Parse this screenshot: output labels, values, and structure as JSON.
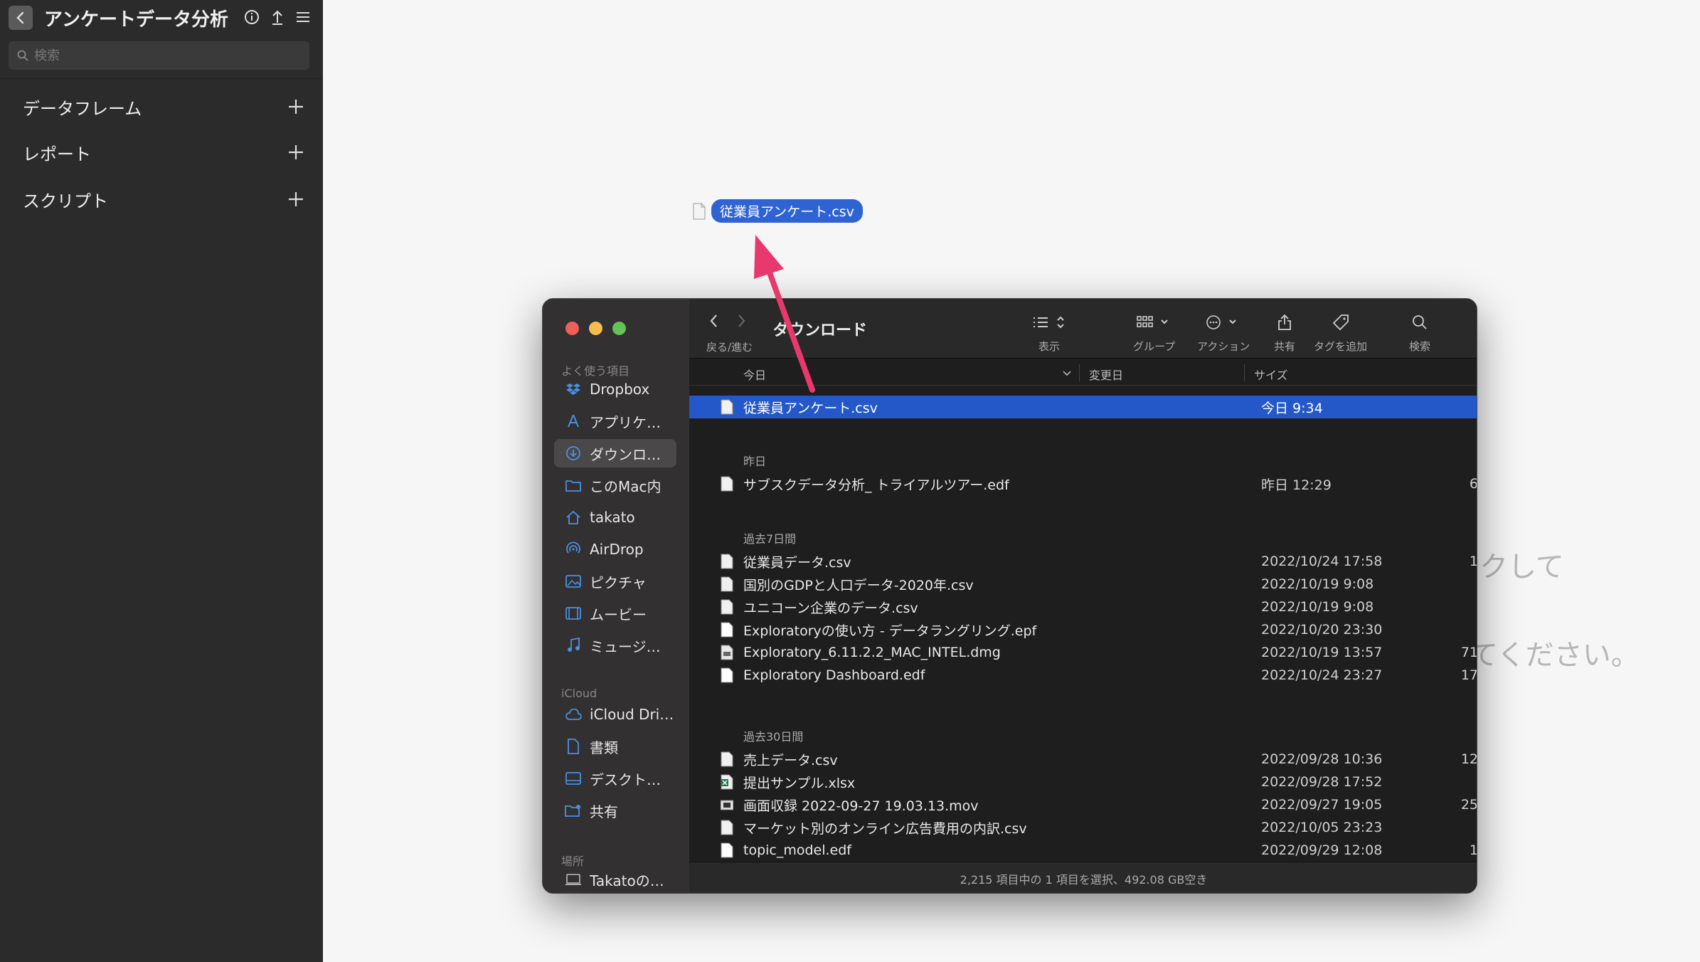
{
  "app": {
    "title": "アンケートデータ分析",
    "search_placeholder": "検索",
    "sections": [
      {
        "label": "データフレーム"
      },
      {
        "label": "レポート"
      },
      {
        "label": "スクリプト"
      }
    ]
  },
  "background_text": {
    "line1": "クして",
    "line2": "てください。"
  },
  "drag": {
    "file_name": "従業員アンケート.csv"
  },
  "finder": {
    "folder_title": "ダウンロード",
    "nav_label": "戻る/進む",
    "toolbar": {
      "view": "表示",
      "group": "グループ",
      "action": "アクション",
      "share": "共有",
      "tag": "タグを追加",
      "search": "検索"
    },
    "sidebar": {
      "favorites_label": "よく使う項目",
      "favorites": [
        {
          "label": "Dropbox",
          "icon": "dropbox-icon"
        },
        {
          "label": "アプリケ…",
          "icon": "applications-icon"
        },
        {
          "label": "ダウンロ…",
          "icon": "downloads-icon"
        },
        {
          "label": "このMac内",
          "icon": "folder-icon"
        },
        {
          "label": "takato",
          "icon": "home-icon"
        },
        {
          "label": "AirDrop",
          "icon": "airdrop-icon"
        },
        {
          "label": "ピクチャ",
          "icon": "pictures-icon"
        },
        {
          "label": "ムービー",
          "icon": "movies-icon"
        },
        {
          "label": "ミュージ…",
          "icon": "music-icon"
        }
      ],
      "icloud_label": "iCloud",
      "icloud": [
        {
          "label": "iCloud Dri…",
          "icon": "cloud-icon"
        },
        {
          "label": "書類",
          "icon": "document-icon"
        },
        {
          "label": "デスクト…",
          "icon": "desktop-icon"
        },
        {
          "label": "共有",
          "icon": "shared-folder-icon"
        }
      ],
      "places_label": "場所",
      "places": [
        {
          "label": "Takatoの…",
          "icon": "laptop-icon"
        }
      ]
    },
    "columns": {
      "name": "今日",
      "date": "変更日",
      "size": "サイズ"
    },
    "groups": [
      {
        "label": "",
        "files": [
          {
            "name": "従業員アンケート.csv",
            "date": "今日 9:34",
            "size": ""
          }
        ]
      },
      {
        "label": "昨日",
        "files": [
          {
            "name": "サブスクデータ分析_ トライアルツアー.edf",
            "date": "昨日 12:29",
            "size": "6"
          }
        ]
      },
      {
        "label": "過去7日間",
        "files": [
          {
            "name": "従業員データ.csv",
            "date": "2022/10/24 17:58",
            "size": "1"
          },
          {
            "name": "国別のGDPと人口データ-2020年.csv",
            "date": "2022/10/19 9:08",
            "size": ""
          },
          {
            "name": "ユニコーン企業のデータ.csv",
            "date": "2022/10/19 9:08",
            "size": ""
          },
          {
            "name": "Exploratoryの使い方 - データラングリング.epf",
            "date": "2022/10/20 23:30",
            "size": ""
          },
          {
            "name": "Exploratory_6.11.2.2_MAC_INTEL.dmg",
            "date": "2022/10/19 13:57",
            "size": "71"
          },
          {
            "name": "Exploratory Dashboard.edf",
            "date": "2022/10/24 23:27",
            "size": "17"
          }
        ]
      },
      {
        "label": "過去30日間",
        "files": [
          {
            "name": "売上データ.csv",
            "date": "2022/09/28 10:36",
            "size": "12"
          },
          {
            "name": "提出サンプル.xlsx",
            "date": "2022/09/28 17:52",
            "size": ""
          },
          {
            "name": "画面収録 2022-09-27 19.03.13.mov",
            "date": "2022/09/27 19:05",
            "size": "25"
          },
          {
            "name": "マーケット別のオンライン広告費用の内訳.csv",
            "date": "2022/10/05 23:23",
            "size": ""
          },
          {
            "name": "topic_model.edf",
            "date": "2022/09/29 12:08",
            "size": "1"
          }
        ]
      }
    ],
    "status": "2,215 項目中の 1 項目を選択、492.08 GB空き"
  },
  "colors": {
    "selection": "#2458c9",
    "drag_label": "#2f63d3",
    "arrow": "#e8386d",
    "close": "#ee5f57",
    "minimize": "#f5bd4f",
    "zoom": "#61c454"
  }
}
